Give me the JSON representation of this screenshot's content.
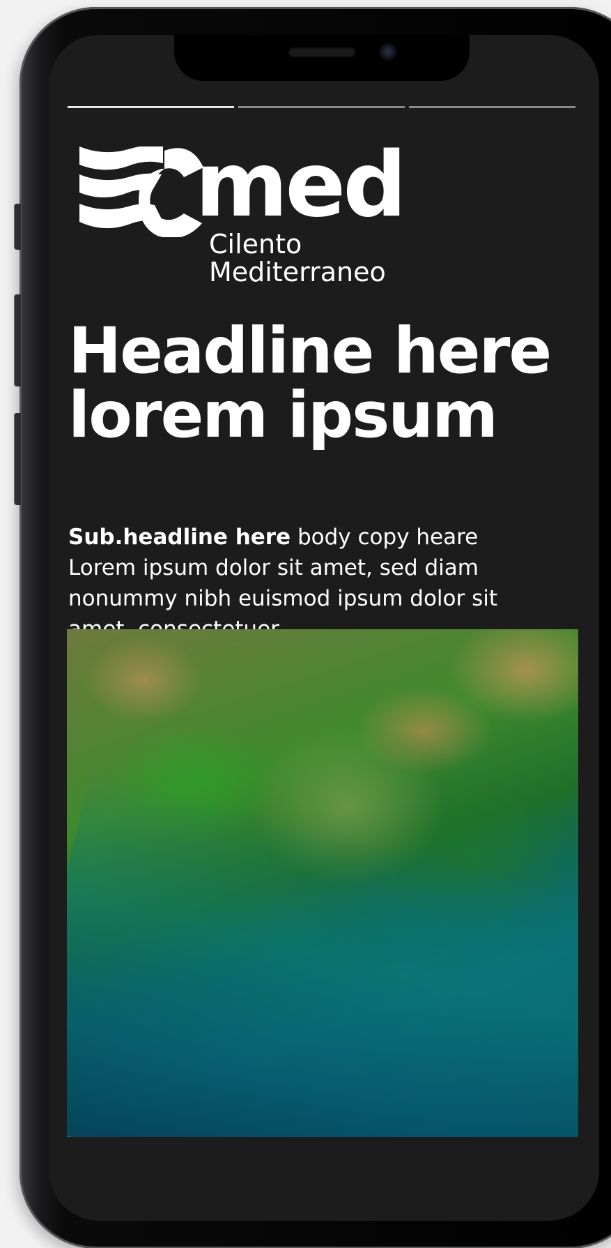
{
  "progress": {
    "segments": 3,
    "active_segment": 1
  },
  "logo": {
    "wordmark": "med",
    "subline_1": "Cilento",
    "subline_2": "Mediterraneo",
    "icon": "wave-c-logo-icon"
  },
  "headline": {
    "line_1": "Headline here",
    "line_2": "lorem ipsum"
  },
  "body": {
    "subheadline": "Sub.headline here",
    "copy": " body copy heare Lorem ipsum dolor sit amet, sed diam nonummy nibh euismod ipsum dolor sit amet, consectetuer"
  },
  "image": {
    "subject": "green mossy rocks meeting turquoise sea"
  },
  "colors": {
    "screen_background": "#1c1c1c",
    "text": "#ffffff",
    "progress_active": "#e8e8e8",
    "progress_inactive": "#8a8a8a"
  }
}
